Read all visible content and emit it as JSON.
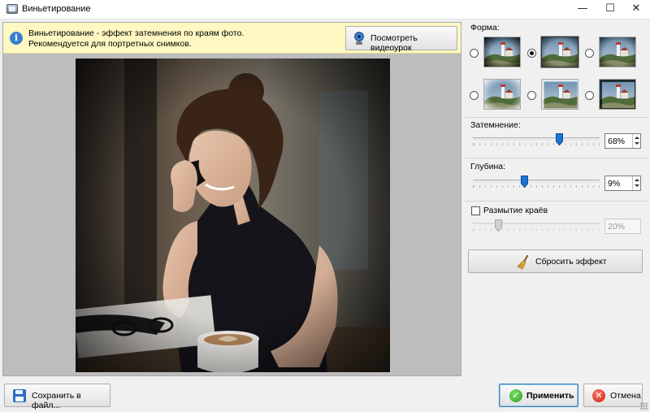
{
  "window": {
    "title": "Виньетирование",
    "controls": {
      "minimize": "—",
      "maximize": "☐",
      "close": "✕"
    }
  },
  "info": {
    "line1": "Виньетирование - эффект затемнения по краям фото.",
    "line2": "Рекомендуется для портретных снимков.",
    "video_button": "Посмотреть видеоурок"
  },
  "panel": {
    "shape_label": "Форма:",
    "shapes": [
      {
        "name": "dark-oval",
        "selected": false
      },
      {
        "name": "light-soft",
        "selected": true
      },
      {
        "name": "dark-soft",
        "selected": false
      },
      {
        "name": "light-rect",
        "selected": false
      },
      {
        "name": "rect-dark",
        "selected": false
      },
      {
        "name": "rect-soft",
        "selected": false
      }
    ],
    "darkening": {
      "label": "Затемнение:",
      "value": "68%",
      "fraction": 0.68
    },
    "depth": {
      "label": "Глубина:",
      "value": "9%",
      "fraction": 0.41
    },
    "blur": {
      "label": "Размытие краёв",
      "value": "20%",
      "fraction": 0.2,
      "checked": false
    },
    "reset_button": "Сбросить эффект"
  },
  "footer": {
    "save_button": "Сохранить в файл...",
    "apply_button": "Применить",
    "cancel_button": "Отмена"
  },
  "colors": {
    "accent": "#1e73d2",
    "info_bg": "#fff8c2",
    "apply_border": "#3c7fb1"
  }
}
